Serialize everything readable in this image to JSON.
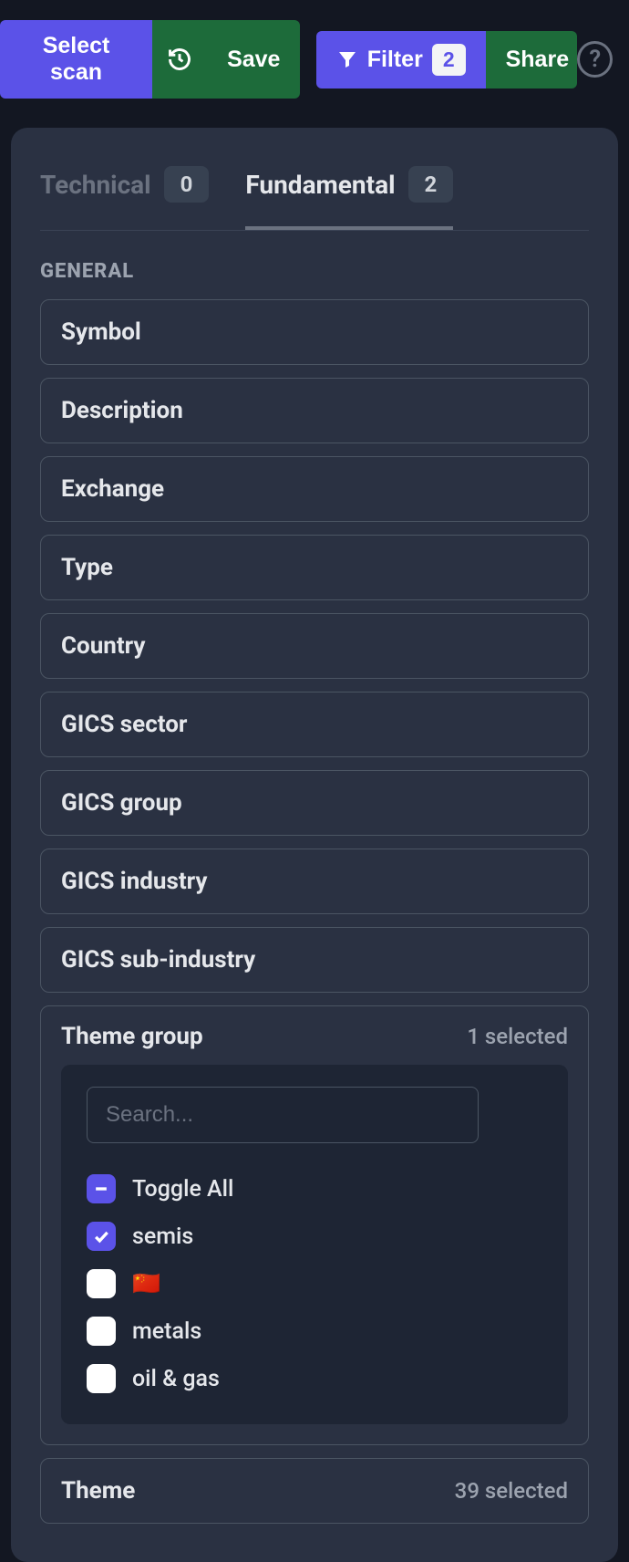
{
  "toolbar": {
    "select_scan": "Select scan",
    "save": "Save",
    "filter": "Filter",
    "filter_count": "2",
    "share": "Share"
  },
  "tabs": {
    "technical": {
      "label": "Technical",
      "count": "0"
    },
    "fundamental": {
      "label": "Fundamental",
      "count": "2"
    }
  },
  "section": "GENERAL",
  "fields": {
    "symbol": "Symbol",
    "description": "Description",
    "exchange": "Exchange",
    "type": "Type",
    "country": "Country",
    "gics_sector": "GICS sector",
    "gics_group": "GICS group",
    "gics_industry": "GICS industry",
    "gics_sub_industry": "GICS sub-industry"
  },
  "theme_group": {
    "label": "Theme group",
    "selected": "1 selected",
    "search_placeholder": "Search...",
    "toggle_all": "Toggle All",
    "options": {
      "semis": "semis",
      "china": "🇨🇳",
      "metals": "metals",
      "oil_gas": "oil & gas"
    }
  },
  "theme": {
    "label": "Theme",
    "selected": "39 selected"
  }
}
